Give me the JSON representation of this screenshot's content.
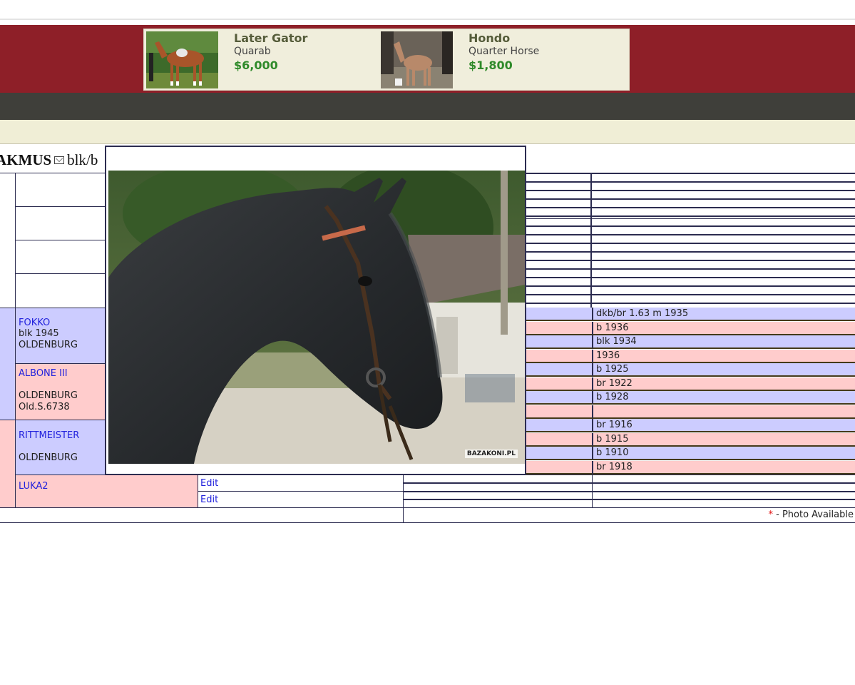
{
  "ads": [
    {
      "name": "Later Gator",
      "breed": "Quarab",
      "price": "$6,000"
    },
    {
      "name": "Hondo",
      "breed": "Quarter Horse",
      "price": "$1,800"
    }
  ],
  "horse": {
    "name_fragment": "AKMUS",
    "color_fragment": "blk/b"
  },
  "pedigree": {
    "fokko": {
      "name": "FOKKO",
      "line1": "blk 1945",
      "line2": "OLDENBURG"
    },
    "albone": {
      "name": "ALBONE III",
      "line1": "OLDENBURG",
      "line2": "Old.S.6738"
    },
    "rittmeister": {
      "name": "RITTMEISTER",
      "line1": "OLDENBURG"
    },
    "luka": {
      "name": "LUKA2"
    },
    "edit1": "Edit",
    "edit2": "Edit"
  },
  "right_rows": [
    {
      "text": "dkb/br 1.63 m 1935",
      "color": "blue"
    },
    {
      "text": "b 1936",
      "color": "pink"
    },
    {
      "text": "blk 1934",
      "color": "blue"
    },
    {
      "text": "1936",
      "color": "pink"
    },
    {
      "text": "b 1925",
      "color": "blue"
    },
    {
      "text": "br 1922",
      "color": "pink"
    },
    {
      "text": "b 1928",
      "color": "blue"
    },
    {
      "text": "",
      "color": "pink"
    },
    {
      "text": "br 1916",
      "color": "blue"
    },
    {
      "text": "b 1915",
      "color": "pink"
    },
    {
      "text": "b 1910",
      "color": "blue"
    },
    {
      "text": "br 1918",
      "color": "pink"
    }
  ],
  "photo": {
    "watermark": "BAZAKONI.PL"
  },
  "legend": {
    "asterisk": "*",
    "text": " - Photo Available"
  },
  "colors": {
    "header_red": "#8e1f28",
    "dark_bar": "#3f3f3a",
    "cream_bar": "#f0eed6",
    "sire_blue": "#ccccff",
    "dam_pink": "#ffcccc"
  }
}
